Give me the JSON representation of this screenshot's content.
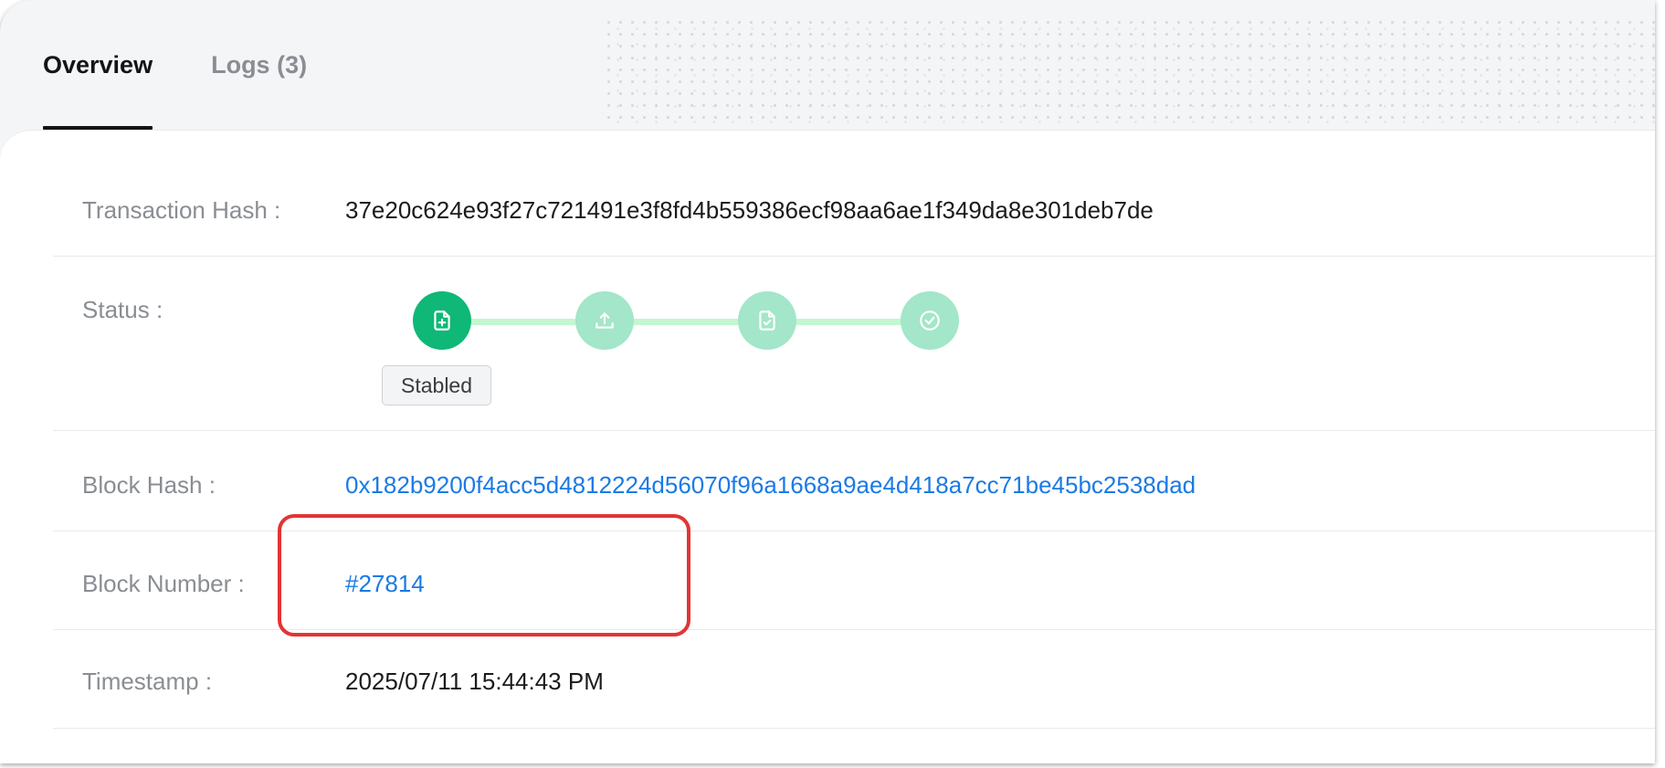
{
  "tabs": [
    {
      "label": "Overview",
      "active": true
    },
    {
      "label": "Logs (3)",
      "active": false
    }
  ],
  "fields": {
    "tx_hash": {
      "label": "Transaction Hash",
      "value": "37e20c624e93f27c721491e3f8fd4b559386ecf98aa6ae1f349da8e301deb7de"
    },
    "status": {
      "label": "Status",
      "current_step_label": "Stabled",
      "steps": [
        {
          "icon": "file-add-icon",
          "state": "done"
        },
        {
          "icon": "upload-icon",
          "state": "pending"
        },
        {
          "icon": "file-check-icon",
          "state": "pending"
        },
        {
          "icon": "check-circle-icon",
          "state": "pending"
        }
      ]
    },
    "block_hash": {
      "label": "Block Hash",
      "value": "0x182b9200f4acc5d4812224d56070f96a1668a9ae4d418a7cc71be45bc2538dad"
    },
    "block_number": {
      "label": "Block Number",
      "value": "#27814"
    },
    "timestamp": {
      "label": "Timestamp",
      "value": "2025/07/11 15:44:43 PM"
    }
  },
  "colors": {
    "step_done": "#0fb877",
    "step_pending": "#a3e6c9",
    "track": "#c3f7cf",
    "link": "#1a7ae6",
    "highlight": "#e23434"
  }
}
